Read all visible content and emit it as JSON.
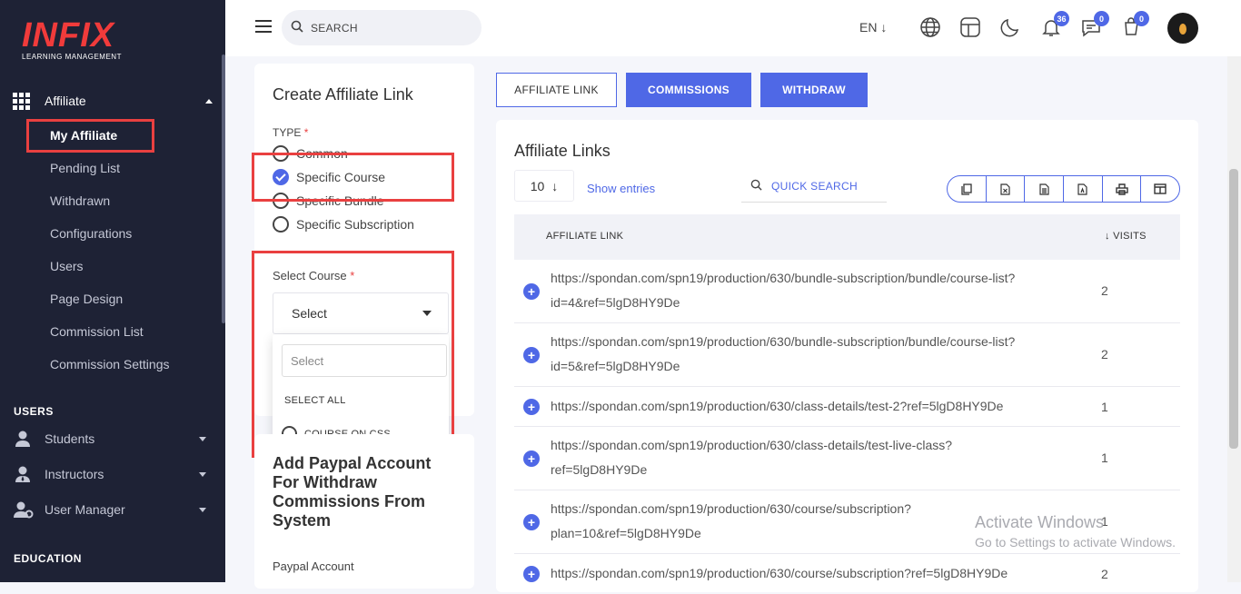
{
  "app": {
    "logo_text": "INFIX",
    "logo_sub": "LEARNING MANAGEMENT"
  },
  "sidebar": {
    "affiliate_label": "Affiliate",
    "items": [
      {
        "label": "My Affiliate"
      },
      {
        "label": "Pending List"
      },
      {
        "label": "Withdrawn"
      },
      {
        "label": "Configurations"
      },
      {
        "label": "Users"
      },
      {
        "label": "Page Design"
      },
      {
        "label": "Commission List"
      },
      {
        "label": "Commission Settings"
      }
    ],
    "users_section": "USERS",
    "groups": [
      {
        "label": "Students"
      },
      {
        "label": "Instructors"
      },
      {
        "label": "User Manager"
      }
    ],
    "education_section": "EDUCATION"
  },
  "topbar": {
    "search_placeholder": "SEARCH",
    "language": "EN",
    "notifications_count": "36",
    "messages_count": "0",
    "cart_count": "0"
  },
  "create_link": {
    "title": "Create Affiliate Link",
    "type_label": "TYPE",
    "required_mark": "*",
    "options": [
      "Common",
      "Specific Course",
      "Specific Bundle",
      "Specific Subscription"
    ],
    "selected_option": "Specific Course",
    "select_course_label": "Select Course",
    "select_value": "Select",
    "dropdown_search_placeholder": "Select",
    "select_all": "SELECT ALL",
    "course_option": "COURSE ON CSS"
  },
  "paypal": {
    "title": "Add Paypal Account For Withdraw Commissions From System",
    "account_label": "Paypal Account"
  },
  "tabs": {
    "affiliate_link": "AFFILIATE LINK",
    "commissions": "COMMISSIONS",
    "withdraw": "WITHDRAW"
  },
  "links_table": {
    "title": "Affiliate Links",
    "per_page": "10",
    "show_entries": "Show entries",
    "quick_search": "QUICK SEARCH",
    "columns": [
      "AFFILIATE LINK",
      "VISITS"
    ],
    "rows": [
      {
        "link": "https://spondan.com/spn19/production/630/bundle-subscription/bundle/course-list?id=4&ref=5lgD8HY9De",
        "visits": "2"
      },
      {
        "link": "https://spondan.com/spn19/production/630/bundle-subscription/bundle/course-list?id=5&ref=5lgD8HY9De",
        "visits": "2"
      },
      {
        "link": "https://spondan.com/spn19/production/630/class-details/test-2?ref=5lgD8HY9De",
        "visits": "1"
      },
      {
        "link": "https://spondan.com/spn19/production/630/class-details/test-live-class?ref=5lgD8HY9De",
        "visits": "1"
      },
      {
        "link": "https://spondan.com/spn19/production/630/course/subscription?plan=10&ref=5lgD8HY9De",
        "visits": "1"
      },
      {
        "link": "https://spondan.com/spn19/production/630/course/subscription?ref=5lgD8HY9De",
        "visits": "2"
      }
    ]
  },
  "watermark": {
    "line1": "Activate Windows",
    "line2": "Go to Settings to activate Windows."
  },
  "colors": {
    "accent": "#4f68e6",
    "sidebar_bg": "#1e2235",
    "highlight": "#e94040",
    "logo": "#f13b3b"
  }
}
